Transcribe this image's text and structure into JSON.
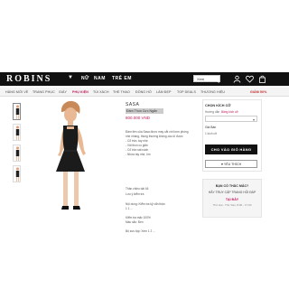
{
  "header": {
    "logo": "ROBINS",
    "tabs": [
      "NỮ",
      "NAM",
      "TRẺ EM"
    ],
    "search": {
      "value": "Xem"
    }
  },
  "categories": [
    "HÀNG MỚI VỀ",
    "TRANG PHỤC",
    "GIÀY",
    "PHỤ KIỆN",
    "TÚI XÁCH",
    "THỂ THAO",
    "ĐỒNG HỒ",
    "LÀM ĐẸP",
    "TOP DEALS",
    "THƯƠNG HIỆU",
    "GIẢM 50%"
  ],
  "product": {
    "brand": "SASA",
    "name": "Đầm Thun Cực Ngắn",
    "price": "800.000 VND",
    "description": [
      "Đầm liền của Sasa được may cắt với form phòng",
      "nhẹ nhàng, thùng thướng không cầu kì được",
      "- Cổ tròn, tay nhẹ",
      "- Vải thun co giãn",
      "- Cổ tròn sát nách",
      "- Nhựa tay nhẹ, ôm",
      "",
      "Thân chiều dài 46",
      "Lưu ý kiểm tra",
      "",
      "Nội dung: Kiểm tra kỹ cẩn thận",
      "1 1 ...",
      "",
      "Kiểm tra mặc 100%",
      "Màu sắc: Đen",
      "",
      "Bộ sưu tập: Xem 1 2 ..."
    ]
  },
  "sidebar": {
    "size_title": "CHỌN KÍCH CỠ",
    "size_sub": "Hướng dẫn",
    "size_link": "Bảng kích cỡ",
    "size_placeholder": "",
    "qty_label": "Giá Bán",
    "qty_value": "1 kích cỡ",
    "add_to_cart": "CHO VÀO GIỎ HÀNG",
    "save": "♥ YÊU THÍCH"
  },
  "help": {
    "title": "BẠN CÓ THẮC MẮC?",
    "line": "HÃY TRUY CẬP TRANG HỖI ĐÁP",
    "link": "TẠI ĐÂY",
    "hours": "Thứ Hai - Thứ Sáu: 8:00 - 17:00"
  },
  "colors": {
    "topbar": "#111111",
    "accent": "#c2185b",
    "sale": "#c62828"
  }
}
